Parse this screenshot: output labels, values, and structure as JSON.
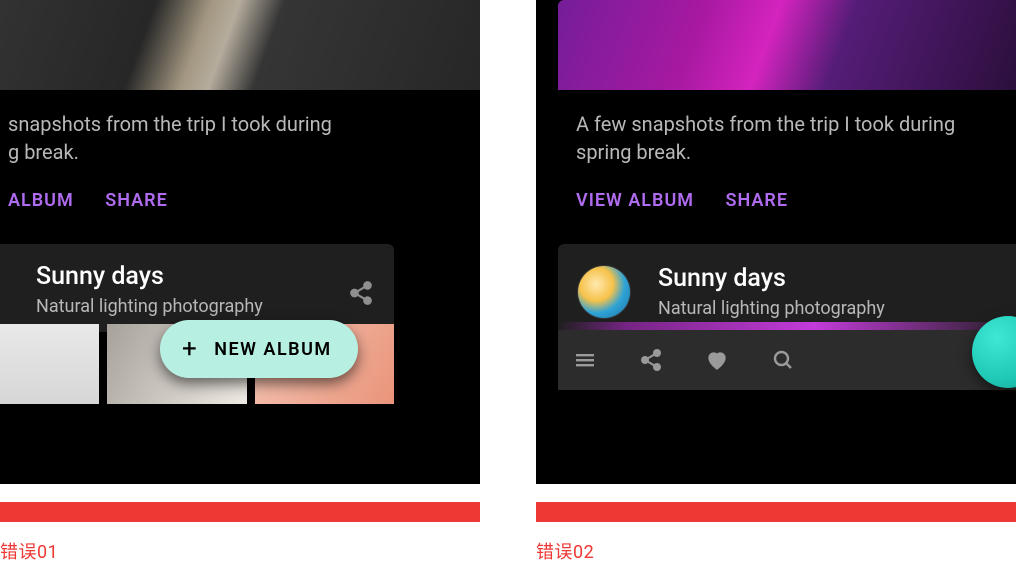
{
  "left": {
    "caption": "错误01",
    "snapshot_text": "snapshots from the trip I took during\ng break.",
    "actions": {
      "view": "ALBUM",
      "share": "SHARE"
    },
    "card2": {
      "title": "Sunny days",
      "subtitle": "Natural lighting photography"
    },
    "fab_label": "NEW ALBUM"
  },
  "right": {
    "caption": "错误02",
    "snapshot_text": "A few snapshots from the trip I took during\nspring break.",
    "actions": {
      "view": "VIEW ALBUM",
      "share": "SHARE"
    },
    "card2": {
      "title": "Sunny days",
      "subtitle": "Natural lighting photography"
    }
  },
  "icons": {
    "share": "share-icon",
    "plus": "plus-icon",
    "menu": "menu-icon",
    "heart": "heart-icon",
    "search": "search-icon"
  },
  "colors": {
    "accent_purple": "#b06cf0",
    "fab_bg": "#b7f0e2",
    "error_red": "#ed3833",
    "teal_fab": "#1fc9b6"
  }
}
